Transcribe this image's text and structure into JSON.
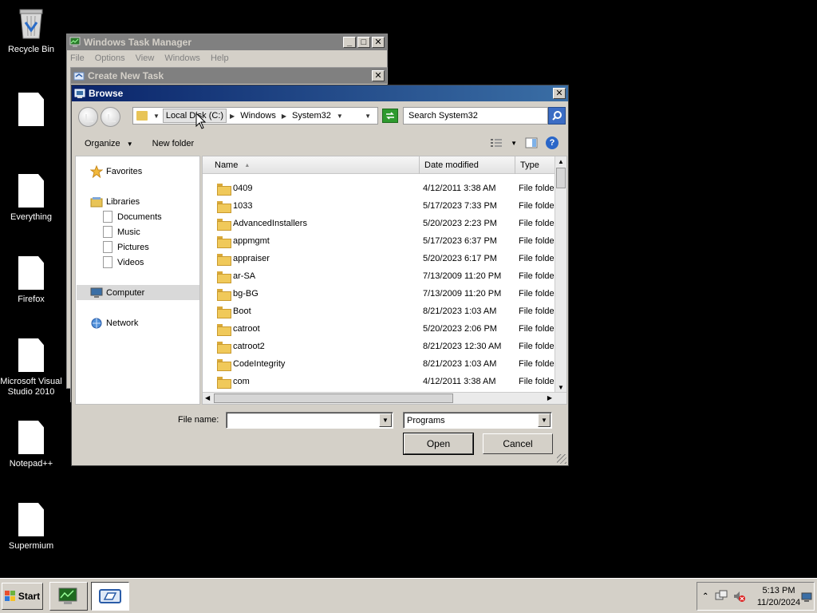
{
  "desktop": {
    "icons": [
      {
        "label": "Recycle Bin",
        "icon": "recycle-bin-icon"
      },
      {
        "label": "",
        "icon": "document-icon"
      },
      {
        "label": "Everything",
        "icon": "document-icon"
      },
      {
        "label": "Firefox",
        "icon": "document-icon"
      },
      {
        "label": "Microsoft Visual Studio 2010",
        "icon": "document-icon"
      },
      {
        "label": "Notepad++",
        "icon": "document-icon"
      },
      {
        "label": "Supermium",
        "icon": "document-icon"
      }
    ]
  },
  "task_manager": {
    "title": "Windows Task Manager",
    "menu": [
      "File",
      "Options",
      "View",
      "Windows",
      "Help"
    ]
  },
  "create_task": {
    "title": "Create New Task"
  },
  "browse": {
    "title": "Browse",
    "address": {
      "crumbs": [
        "Local Disk (C:)",
        "Windows",
        "System32"
      ]
    },
    "search_placeholder": "Search System32",
    "toolbar": {
      "organize": "Organize",
      "new_folder": "New folder"
    },
    "nav": {
      "favorites": "Favorites",
      "libraries": "Libraries",
      "library_items": [
        "Documents",
        "Music",
        "Pictures",
        "Videos"
      ],
      "computer": "Computer",
      "network": "Network"
    },
    "columns": {
      "name": "Name",
      "date": "Date modified",
      "type": "Type"
    },
    "files": [
      {
        "name": "0409",
        "date": "4/12/2011 3:38 AM",
        "type": "File folder"
      },
      {
        "name": "1033",
        "date": "5/17/2023 7:33 PM",
        "type": "File folder"
      },
      {
        "name": "AdvancedInstallers",
        "date": "5/20/2023 2:23 PM",
        "type": "File folder"
      },
      {
        "name": "appmgmt",
        "date": "5/17/2023 6:37 PM",
        "type": "File folder"
      },
      {
        "name": "appraiser",
        "date": "5/20/2023 6:17 PM",
        "type": "File folder"
      },
      {
        "name": "ar-SA",
        "date": "7/13/2009 11:20 PM",
        "type": "File folder"
      },
      {
        "name": "bg-BG",
        "date": "7/13/2009 11:20 PM",
        "type": "File folder"
      },
      {
        "name": "Boot",
        "date": "8/21/2023 1:03 AM",
        "type": "File folder"
      },
      {
        "name": "catroot",
        "date": "5/20/2023 2:06 PM",
        "type": "File folder"
      },
      {
        "name": "catroot2",
        "date": "8/21/2023 12:30 AM",
        "type": "File folder"
      },
      {
        "name": "CodeIntegrity",
        "date": "8/21/2023 1:03 AM",
        "type": "File folder"
      },
      {
        "name": "com",
        "date": "4/12/2011 3:38 AM",
        "type": "File folder"
      }
    ],
    "file_name_label": "File name:",
    "file_name_value": "",
    "file_type": "Programs",
    "open_label": "Open",
    "cancel_label": "Cancel"
  },
  "taskbar": {
    "start_label": "Start",
    "time": "5:13 PM",
    "date": "11/20/2024"
  }
}
